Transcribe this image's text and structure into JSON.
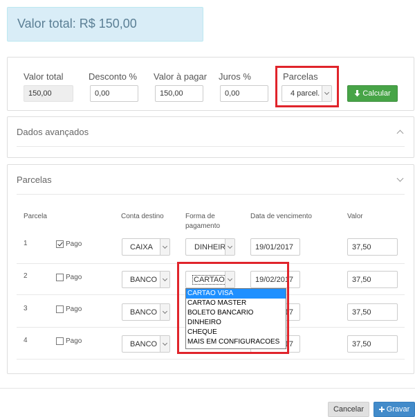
{
  "header": {
    "total_label": "Valor total: R$ 150,00"
  },
  "summary": {
    "valor_total": {
      "label": "Valor total",
      "value": "150,00"
    },
    "desconto": {
      "label": "Desconto %",
      "value": "0,00"
    },
    "valor_pagar": {
      "label": "Valor à pagar",
      "value": "150,00"
    },
    "juros": {
      "label": "Juros %",
      "value": "0,00"
    },
    "parcelas": {
      "label": "Parcelas",
      "value": "4 parcel."
    },
    "calcular_label": "Calcular"
  },
  "advanced": {
    "title": "Dados avançados"
  },
  "parcelas_section": {
    "title": "Parcelas",
    "headers": {
      "parcela": "Parcela",
      "conta": "Conta destino",
      "forma_l1": "Forma de",
      "forma_l2": "pagamento",
      "data": "Data de vencimento",
      "valor": "Valor"
    },
    "pago_label": "Pago",
    "rows": [
      {
        "num": "1",
        "pago": true,
        "conta": "CAIXA",
        "forma": "DINHEIR",
        "data": "19/01/2017",
        "valor": "37,50"
      },
      {
        "num": "2",
        "pago": false,
        "conta": "BANCO",
        "forma": "CARTAO",
        "data": "19/02/2017",
        "valor": "37,50"
      },
      {
        "num": "3",
        "pago": false,
        "conta": "BANCO",
        "forma": "",
        "data": "17",
        "valor": "37,50"
      },
      {
        "num": "4",
        "pago": false,
        "conta": "BANCO",
        "forma": "",
        "data": "17",
        "valor": "37,50"
      }
    ],
    "dropdown_options": [
      "CARTAO VISA",
      "CARTAO MASTER",
      "BOLETO BANCARIO",
      "DINHEIRO",
      "CHEQUE",
      "MAIS EM CONFIGURACOES"
    ]
  },
  "footer": {
    "cancel_label": "Cancelar",
    "save_label": "Gravar"
  },
  "colors": {
    "accent_green": "#47a447",
    "accent_blue": "#428bca",
    "highlight_red": "#e0242b",
    "info_bg": "#d9edf7"
  }
}
